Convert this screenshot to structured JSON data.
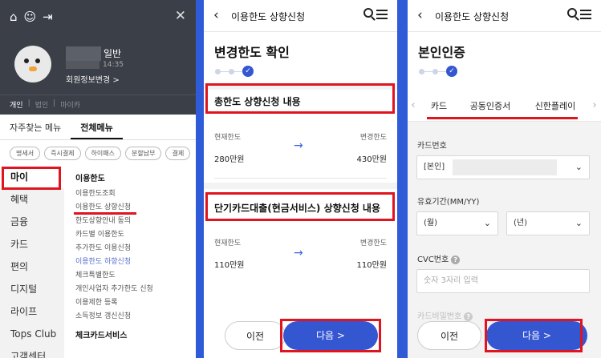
{
  "screen1": {
    "grade": "일반",
    "time": "14:35",
    "member_edit": "회원정보변경 >",
    "member_types": [
      "개인",
      "법인",
      "마이카"
    ],
    "tabs": [
      "자주찾는 메뉴",
      "전체메뉴"
    ],
    "chips": [
      "명세서",
      "즉시결제",
      "하이패스",
      "분할납부",
      "결제"
    ],
    "side_menu": [
      "마이",
      "혜택",
      "금융",
      "카드",
      "편의",
      "디지털",
      "라이프",
      "Tops Club",
      "고객센터"
    ],
    "menu_head": "이용한도",
    "menu_items": [
      "이용한도조회",
      "이용한도 상향신청",
      "한도상향안내 동의",
      "카드별 이용한도",
      "추가한도 이용신청",
      "이용한도 하향신청",
      "체크특별한도",
      "개인사업자 추가한도 신청",
      "이용제한 등록",
      "소득정보 갱신신청"
    ],
    "menu_head2": "체크카드서비스"
  },
  "screen2": {
    "header_title": "이용한도 상향신청",
    "page_title": "변경한도 확인",
    "section1_title": "총한도 상향신청 내용",
    "section2_title": "단기카드대출(현금서비스) 상향신청 내용",
    "current_label": "현재한도",
    "changed_label": "변경한도",
    "total_current": "280만원",
    "total_changed": "430만원",
    "cash_current": "110만원",
    "cash_changed": "110만원",
    "prev_button": "이전",
    "next_button": "다음 >"
  },
  "screen3": {
    "header_title": "이용한도 상향신청",
    "page_title": "본인인증",
    "cert_tabs": [
      "카드",
      "공동인증서",
      "신한플레이"
    ],
    "card_number_label": "카드번호",
    "card_number_value": "[본인]",
    "expiry_label": "유효기간(MM/YY)",
    "month_value": "(월)",
    "year_value": "(년)",
    "cvc_label": "CVC번호",
    "cvc_placeholder": "숫자 3자리 입력",
    "pw_label": "카드비밀번호",
    "prev_button": "이전",
    "next_button": "다음 >"
  },
  "colors": {
    "accent": "#3456d1",
    "highlight": "#e0141e",
    "dark_header": "#3b3f47"
  }
}
